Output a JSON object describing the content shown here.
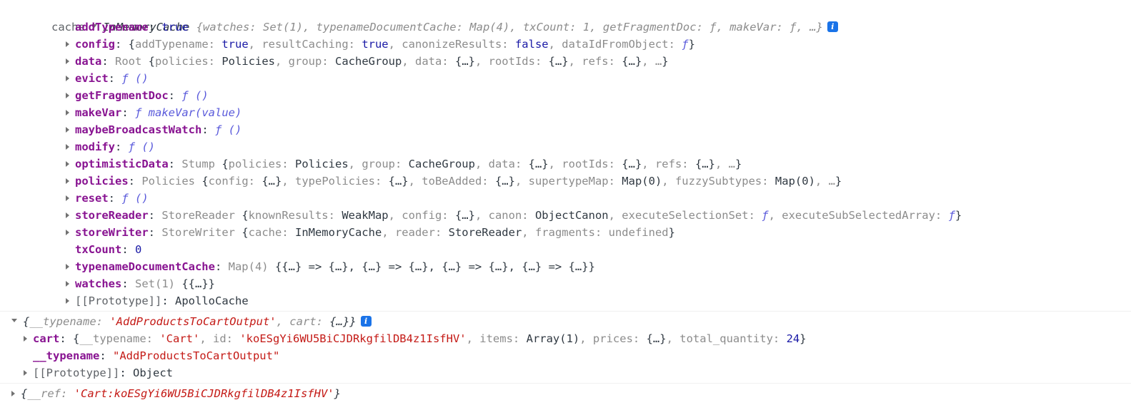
{
  "console": {
    "context_label": "cache",
    "info_badge_glyph": "i",
    "entries": [
      {
        "header": {
          "class_name": "InMemoryCache",
          "preview": "{watches: Set(1), typenameDocumentCache: Map(4), txCount: 1, getFragmentDoc: ƒ, makeVar: ƒ, …}"
        },
        "properties": [
          {
            "name": "addTypename",
            "value": "true",
            "kind": "bool",
            "expandable": false
          },
          {
            "name": "config",
            "value": "{addTypename: true, resultCaching: true, canonizeResults: false, dataIdFromObject: ƒ}",
            "kind": "preview",
            "expandable": true
          },
          {
            "name": "data",
            "value": "Root {policies: Policies, group: CacheGroup, data: {…}, rootIds: {…}, refs: {…}, …}",
            "kind": "preview",
            "expandable": true
          },
          {
            "name": "evict",
            "value": "ƒ ()",
            "kind": "fn",
            "expandable": true
          },
          {
            "name": "getFragmentDoc",
            "value": "ƒ ()",
            "kind": "fn",
            "expandable": true
          },
          {
            "name": "makeVar",
            "value": "ƒ makeVar(value)",
            "kind": "fn",
            "expandable": true
          },
          {
            "name": "maybeBroadcastWatch",
            "value": "ƒ ()",
            "kind": "fn",
            "expandable": true
          },
          {
            "name": "modify",
            "value": "ƒ ()",
            "kind": "fn",
            "expandable": true
          },
          {
            "name": "optimisticData",
            "value": "Stump {policies: Policies, group: CacheGroup, data: {…}, rootIds: {…}, refs: {…}, …}",
            "kind": "preview",
            "expandable": true
          },
          {
            "name": "policies",
            "value": "Policies {config: {…}, typePolicies: {…}, toBeAdded: {…}, supertypeMap: Map(0), fuzzySubtypes: Map(0), …}",
            "kind": "preview",
            "expandable": true
          },
          {
            "name": "reset",
            "value": "ƒ ()",
            "kind": "fn",
            "expandable": true
          },
          {
            "name": "storeReader",
            "value": "StoreReader {knownResults: WeakMap, config: {…}, canon: ObjectCanon, executeSelectionSet: ƒ, executeSubSelectedArray: ƒ}",
            "kind": "preview",
            "expandable": true
          },
          {
            "name": "storeWriter",
            "value": "StoreWriter {cache: InMemoryCache, reader: StoreReader, fragments: undefined}",
            "kind": "preview",
            "expandable": true
          },
          {
            "name": "txCount",
            "value": "0",
            "kind": "num",
            "expandable": false
          },
          {
            "name": "typenameDocumentCache",
            "value": "Map(4) {{…} => {…}, {…} => {…}, {…} => {…}, {…} => {…}}",
            "kind": "preview",
            "expandable": true
          },
          {
            "name": "watches",
            "value": "Set(1) {{…}}",
            "kind": "preview",
            "expandable": true
          },
          {
            "name": "[[Prototype]]",
            "value": "ApolloCache",
            "kind": "internal",
            "expandable": true
          }
        ]
      },
      {
        "header": {
          "class_name": "",
          "preview": "{__typename: 'AddProductsToCartOutput', cart: {…}}"
        },
        "properties": [
          {
            "name": "cart",
            "value": "{__typename: 'Cart', id: 'koESgYi6WU5BiCJDRkgfilDB4z1IsfHV', items: Array(1), prices: {…}, total_quantity: 24}",
            "kind": "preview",
            "expandable": true
          },
          {
            "name": "__typename",
            "value": "\"AddProductsToCartOutput\"",
            "kind": "str",
            "expandable": false
          },
          {
            "name": "[[Prototype]]",
            "value": "Object",
            "kind": "internal",
            "expandable": true
          }
        ]
      },
      {
        "header": {
          "class_name": "",
          "preview": "{__ref: 'Cart:koESgYi6WU5BiCJDRkgfilDB4z1IsfHV'}"
        },
        "properties": []
      }
    ]
  }
}
